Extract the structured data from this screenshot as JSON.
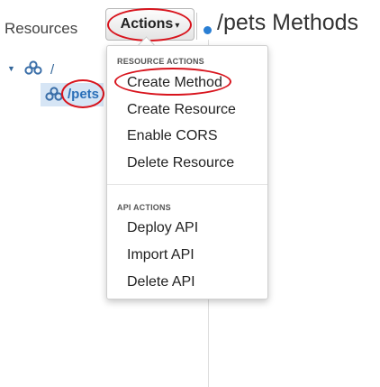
{
  "sidebar": {
    "title": "Resources",
    "tree": [
      {
        "label": "/"
      },
      {
        "label": "/pets"
      }
    ]
  },
  "toolbar": {
    "actions_label": "Actions",
    "actions_caret": "▾"
  },
  "page": {
    "title": "/pets Methods"
  },
  "menu": {
    "resource_header": "RESOURCE ACTIONS",
    "resource_items": [
      "Create Method",
      "Create Resource",
      "Enable CORS",
      "Delete Resource"
    ],
    "api_header": "API ACTIONS",
    "api_items": [
      "Deploy API",
      "Import API",
      "Delete API"
    ]
  },
  "colors": {
    "highlight_circle": "#d8141d",
    "accent_blue": "#2a7fd4",
    "selected_row": "#d6e5f5"
  },
  "icons": [
    "caret-down-icon",
    "resource-tree-icon",
    "status-dot-icon"
  ]
}
